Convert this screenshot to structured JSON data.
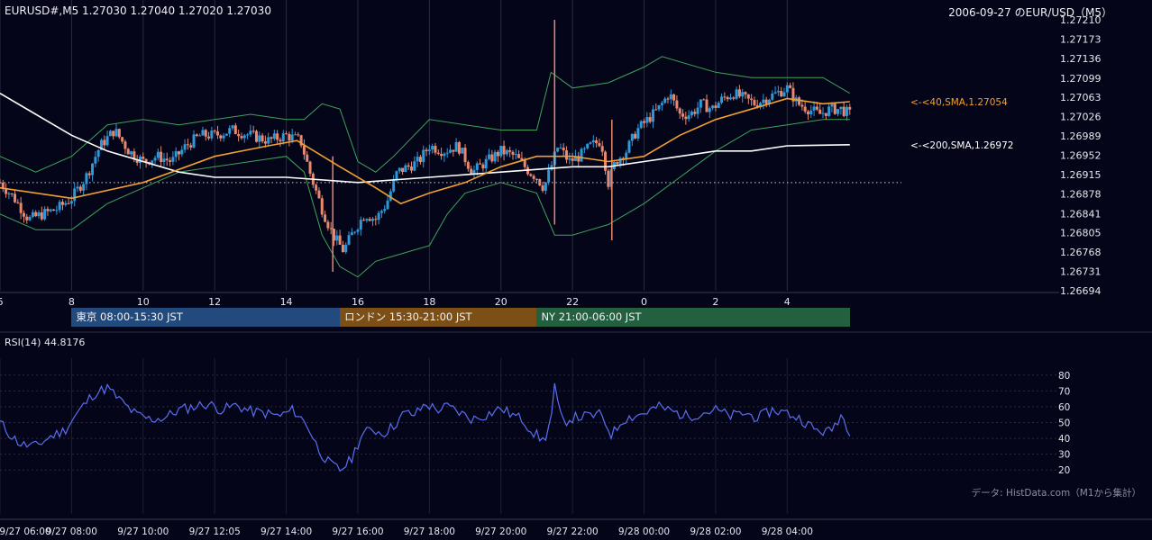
{
  "header": {
    "symbol_ohlc": "EURUSD#,M5 1.27030 1.27040 1.27020 1.27030",
    "date_title": "2006-09-27 のEUR/USD（M5）"
  },
  "sessions": [
    {
      "label": "東京 08:00-15:30 JST",
      "color": "#234a7c"
    },
    {
      "label": "ロンドン 15:30-21:00 JST",
      "color": "#7c4f17"
    },
    {
      "label": "NY 21:00-06:00 JST",
      "color": "#23603f"
    }
  ],
  "rsi": {
    "label": "RSI(14) 44.8176"
  },
  "credit": "データ: HistData.com（M1から集計）",
  "colors": {
    "background": "#050519",
    "candle_up": "#2f98d8",
    "candle_down": "#e8886e",
    "sma40": "#f0a030",
    "sma200": "#ffffff",
    "bollinger": "#3fa35a",
    "rsi": "#5a6ef0",
    "grid": "#2a2a40"
  },
  "chart_data": [
    {
      "type": "candlestick",
      "title": "2006-09-27 のEUR/USD（M5）",
      "symbol": "EURUSD#,M5",
      "last_ohlc": {
        "open": 1.2703,
        "high": 1.2704,
        "low": 1.2702,
        "close": 1.2703
      },
      "price_ticks": [
        "1.27210",
        "1.27173",
        "1.27136",
        "1.27099",
        "1.27063",
        "1.27026",
        "1.26989",
        "1.26952",
        "1.26915",
        "1.26878",
        "1.26841",
        "1.26805",
        "1.26768",
        "1.26731",
        "1.26694"
      ],
      "ylim": [
        1.26694,
        1.2721
      ],
      "time_ticks": [
        "6",
        "8",
        "10",
        "12",
        "14",
        "16",
        "18",
        "20",
        "22",
        "0",
        "2",
        "4"
      ],
      "time_tick_hours": [
        6,
        8,
        10,
        12,
        14,
        16,
        18,
        20,
        22,
        24,
        26,
        28
      ],
      "xlim_hours": [
        6,
        35.6
      ],
      "data_end_hour": 29.75,
      "grid": true,
      "reference_line": 1.269,
      "sma_labels": [
        {
          "text": "<-<40,SMA,1.27054",
          "value": 1.27054,
          "color": "#f0a030"
        },
        {
          "text": "<-<200,SMA,1.26972",
          "value": 1.26972,
          "color": "#ffffff"
        }
      ],
      "price_path": [
        [
          6.0,
          1.269
        ],
        [
          6.4,
          1.2687
        ],
        [
          6.8,
          1.2683
        ],
        [
          7.2,
          1.2684
        ],
        [
          7.6,
          1.2685
        ],
        [
          8.0,
          1.2687
        ],
        [
          8.4,
          1.2691
        ],
        [
          8.8,
          1.2697
        ],
        [
          9.2,
          1.27
        ],
        [
          9.6,
          1.2696
        ],
        [
          10.0,
          1.2694
        ],
        [
          10.4,
          1.2695
        ],
        [
          10.8,
          1.2694
        ],
        [
          11.2,
          1.2697
        ],
        [
          11.6,
          1.2699
        ],
        [
          12.0,
          1.2699
        ],
        [
          12.5,
          1.27
        ],
        [
          13.0,
          1.2699
        ],
        [
          13.5,
          1.2698
        ],
        [
          14.0,
          1.2699
        ],
        [
          14.4,
          1.2698
        ],
        [
          14.7,
          1.2691
        ],
        [
          15.0,
          1.2685
        ],
        [
          15.3,
          1.268
        ],
        [
          15.6,
          1.2677
        ],
        [
          15.9,
          1.2681
        ],
        [
          16.2,
          1.2684
        ],
        [
          16.5,
          1.2683
        ],
        [
          16.8,
          1.2686
        ],
        [
          17.1,
          1.2692
        ],
        [
          17.4,
          1.2693
        ],
        [
          17.7,
          1.2694
        ],
        [
          18.0,
          1.2697
        ],
        [
          18.4,
          1.2696
        ],
        [
          18.8,
          1.2697
        ],
        [
          19.2,
          1.2692
        ],
        [
          19.6,
          1.2694
        ],
        [
          20.0,
          1.2696
        ],
        [
          20.4,
          1.2695
        ],
        [
          20.8,
          1.2692
        ],
        [
          21.0,
          1.2691
        ],
        [
          21.2,
          1.2689
        ],
        [
          21.4,
          1.2693
        ],
        [
          21.6,
          1.2697
        ],
        [
          21.9,
          1.2694
        ],
        [
          22.2,
          1.2695
        ],
        [
          22.5,
          1.2697
        ],
        [
          22.8,
          1.2698
        ],
        [
          23.0,
          1.269
        ],
        [
          23.2,
          1.2694
        ],
        [
          23.5,
          1.2696
        ],
        [
          23.8,
          1.27
        ],
        [
          24.1,
          1.2702
        ],
        [
          24.4,
          1.2704
        ],
        [
          24.7,
          1.2707
        ],
        [
          25.0,
          1.2703
        ],
        [
          25.3,
          1.2703
        ],
        [
          25.6,
          1.2705
        ],
        [
          25.9,
          1.2704
        ],
        [
          26.2,
          1.2706
        ],
        [
          26.5,
          1.2707
        ],
        [
          26.8,
          1.2706
        ],
        [
          27.1,
          1.2705
        ],
        [
          27.4,
          1.2706
        ],
        [
          27.7,
          1.2707
        ],
        [
          28.0,
          1.2708
        ],
        [
          28.3,
          1.2705
        ],
        [
          28.6,
          1.2704
        ],
        [
          28.9,
          1.2703
        ],
        [
          29.2,
          1.2704
        ],
        [
          29.5,
          1.2704
        ],
        [
          29.75,
          1.2703
        ]
      ],
      "sma40_path": [
        [
          6.0,
          1.2689
        ],
        [
          8.0,
          1.2687
        ],
        [
          10.0,
          1.269
        ],
        [
          12.0,
          1.2695
        ],
        [
          13.5,
          1.2697
        ],
        [
          14.3,
          1.2698
        ],
        [
          15.5,
          1.2693
        ],
        [
          16.5,
          1.2689
        ],
        [
          17.2,
          1.2686
        ],
        [
          18.0,
          1.2688
        ],
        [
          19.0,
          1.269
        ],
        [
          20.0,
          1.2693
        ],
        [
          21.0,
          1.2695
        ],
        [
          22.0,
          1.2695
        ],
        [
          23.0,
          1.2694
        ],
        [
          24.0,
          1.2695
        ],
        [
          25.0,
          1.2699
        ],
        [
          26.0,
          1.2702
        ],
        [
          27.0,
          1.2704
        ],
        [
          28.0,
          1.2706
        ],
        [
          29.0,
          1.2705
        ],
        [
          29.75,
          1.27054
        ]
      ],
      "sma200_path": [
        [
          6.0,
          1.2707
        ],
        [
          7.0,
          1.2703
        ],
        [
          8.0,
          1.2699
        ],
        [
          9.0,
          1.2696
        ],
        [
          10.0,
          1.2694
        ],
        [
          11.0,
          1.2692
        ],
        [
          12.0,
          1.2691
        ],
        [
          14.0,
          1.2691
        ],
        [
          16.0,
          1.269
        ],
        [
          18.0,
          1.2691
        ],
        [
          20.0,
          1.2692
        ],
        [
          22.0,
          1.2693
        ],
        [
          23.0,
          1.2693
        ],
        [
          24.0,
          1.2694
        ],
        [
          25.0,
          1.2695
        ],
        [
          26.0,
          1.2696
        ],
        [
          27.0,
          1.2696
        ],
        [
          28.0,
          1.2697
        ],
        [
          29.75,
          1.26972
        ]
      ],
      "bb_upper_path": [
        [
          6.0,
          1.2695
        ],
        [
          7.0,
          1.2692
        ],
        [
          8.0,
          1.2695
        ],
        [
          9.0,
          1.2701
        ],
        [
          10.0,
          1.2702
        ],
        [
          11.0,
          1.2701
        ],
        [
          12.0,
          1.2702
        ],
        [
          13.0,
          1.2703
        ],
        [
          14.0,
          1.2702
        ],
        [
          14.5,
          1.2702
        ],
        [
          15.0,
          1.2705
        ],
        [
          15.5,
          1.2704
        ],
        [
          16.0,
          1.2694
        ],
        [
          16.5,
          1.2692
        ],
        [
          17.0,
          1.2695
        ],
        [
          18.0,
          1.2702
        ],
        [
          19.0,
          1.2701
        ],
        [
          20.0,
          1.27
        ],
        [
          21.0,
          1.27
        ],
        [
          21.4,
          1.2711
        ],
        [
          22.0,
          1.2708
        ],
        [
          23.0,
          1.2709
        ],
        [
          24.0,
          1.2712
        ],
        [
          24.5,
          1.2714
        ],
        [
          25.0,
          1.2713
        ],
        [
          26.0,
          1.2711
        ],
        [
          27.0,
          1.271
        ],
        [
          28.0,
          1.271
        ],
        [
          29.0,
          1.271
        ],
        [
          29.75,
          1.2707
        ]
      ],
      "bb_lower_path": [
        [
          6.0,
          1.2684
        ],
        [
          7.0,
          1.2681
        ],
        [
          8.0,
          1.2681
        ],
        [
          9.0,
          1.2686
        ],
        [
          10.0,
          1.2689
        ],
        [
          11.0,
          1.2692
        ],
        [
          12.0,
          1.2693
        ],
        [
          13.0,
          1.2694
        ],
        [
          14.0,
          1.2695
        ],
        [
          14.5,
          1.2692
        ],
        [
          15.0,
          1.268
        ],
        [
          15.5,
          1.2674
        ],
        [
          16.0,
          1.2672
        ],
        [
          16.5,
          1.2675
        ],
        [
          17.0,
          1.2676
        ],
        [
          18.0,
          1.2678
        ],
        [
          18.5,
          1.2684
        ],
        [
          19.0,
          1.2688
        ],
        [
          20.0,
          1.269
        ],
        [
          21.0,
          1.2688
        ],
        [
          21.5,
          1.268
        ],
        [
          22.0,
          1.268
        ],
        [
          22.5,
          1.2681
        ],
        [
          23.0,
          1.2682
        ],
        [
          24.0,
          1.2686
        ],
        [
          25.0,
          1.2691
        ],
        [
          26.0,
          1.2696
        ],
        [
          27.0,
          1.27
        ],
        [
          28.0,
          1.2701
        ],
        [
          29.0,
          1.2702
        ],
        [
          29.75,
          1.2702
        ]
      ],
      "spikes": [
        {
          "hour": 21.5,
          "high": 1.2721,
          "low": 1.2682
        },
        {
          "hour": 23.1,
          "high": 1.2702,
          "low": 1.2679
        },
        {
          "hour": 15.3,
          "high": 1.2695,
          "low": 1.2673
        }
      ]
    },
    {
      "type": "line",
      "title": "RSI(14) 44.8176",
      "y_ticks": [
        "80",
        "70",
        "60",
        "50",
        "40",
        "30",
        "20"
      ],
      "ylim": [
        15,
        85
      ],
      "x_ticks": [
        "9/27 06:00",
        "9/27 08:00",
        "9/27 10:00",
        "9/27 12:05",
        "9/27 14:00",
        "9/27 16:00",
        "9/27 18:00",
        "9/27 20:00",
        "9/27 22:00",
        "9/28 00:00",
        "9/28 02:00",
        "9/28 04:00"
      ],
      "x_tick_hours": [
        6,
        8,
        10,
        12,
        14,
        16,
        18,
        20,
        22,
        24,
        26,
        28
      ],
      "grid": true,
      "values": [
        [
          6.0,
          50
        ],
        [
          6.3,
          42
        ],
        [
          6.6,
          36
        ],
        [
          7.0,
          35
        ],
        [
          7.4,
          41
        ],
        [
          7.8,
          45
        ],
        [
          8.2,
          57
        ],
        [
          8.6,
          68
        ],
        [
          9.0,
          72
        ],
        [
          9.4,
          63
        ],
        [
          9.8,
          55
        ],
        [
          10.2,
          52
        ],
        [
          10.6,
          53
        ],
        [
          11.0,
          58
        ],
        [
          11.4,
          60
        ],
        [
          11.8,
          62
        ],
        [
          12.2,
          58
        ],
        [
          12.6,
          61
        ],
        [
          13.0,
          57
        ],
        [
          13.4,
          56
        ],
        [
          13.8,
          54
        ],
        [
          14.2,
          58
        ],
        [
          14.6,
          48
        ],
        [
          14.9,
          33
        ],
        [
          15.2,
          24
        ],
        [
          15.5,
          20
        ],
        [
          15.8,
          26
        ],
        [
          16.1,
          42
        ],
        [
          16.4,
          46
        ],
        [
          16.7,
          43
        ],
        [
          17.0,
          48
        ],
        [
          17.3,
          56
        ],
        [
          17.6,
          55
        ],
        [
          17.9,
          62
        ],
        [
          18.2,
          58
        ],
        [
          18.5,
          60
        ],
        [
          18.8,
          57
        ],
        [
          19.2,
          52
        ],
        [
          19.6,
          55
        ],
        [
          20.0,
          59
        ],
        [
          20.3,
          55
        ],
        [
          20.6,
          52
        ],
        [
          20.9,
          44
        ],
        [
          21.2,
          38
        ],
        [
          21.4,
          52
        ],
        [
          21.5,
          72
        ],
        [
          21.7,
          50
        ],
        [
          22.0,
          53
        ],
        [
          22.4,
          54
        ],
        [
          22.8,
          55
        ],
        [
          23.1,
          42
        ],
        [
          23.4,
          52
        ],
        [
          23.7,
          54
        ],
        [
          24.0,
          56
        ],
        [
          24.4,
          60
        ],
        [
          24.8,
          57
        ],
        [
          25.2,
          54
        ],
        [
          25.6,
          56
        ],
        [
          26.0,
          58
        ],
        [
          26.4,
          54
        ],
        [
          26.8,
          56
        ],
        [
          27.2,
          53
        ],
        [
          27.6,
          58
        ],
        [
          28.0,
          56
        ],
        [
          28.4,
          52
        ],
        [
          28.8,
          45
        ],
        [
          29.2,
          44
        ],
        [
          29.5,
          55
        ],
        [
          29.75,
          44.8
        ]
      ]
    }
  ]
}
